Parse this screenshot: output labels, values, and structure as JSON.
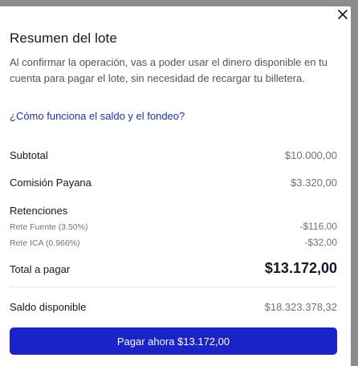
{
  "modal": {
    "title": "Resumen del lote",
    "description": "Al confirmar la operación, vas a poder usar el dinero disponible en tu cuenta para pagar el lote, sin necesidad de recargar tu billetera.",
    "help_link": "¿Cómo funciona el saldo y el fondeo?",
    "close_icon": "close-icon"
  },
  "summary": {
    "subtotal": {
      "label": "Subtotal",
      "value": "$10.000,00"
    },
    "commission": {
      "label": "Comisión Payana",
      "value": "$3.320,00"
    },
    "withholdings": {
      "label": "Retenciones",
      "items": [
        {
          "label": "Rete Fuente (3.50%)",
          "value": "-$116,00"
        },
        {
          "label": "Rete ICA (0.966%)",
          "value": "-$32,00"
        }
      ]
    },
    "total": {
      "label": "Total a pagar",
      "value": "$13.172,00"
    },
    "balance": {
      "label": "Saldo disponible",
      "value": "$18.323.378,32"
    }
  },
  "actions": {
    "pay_label": "Pagar ahora $13.172,00"
  },
  "colors": {
    "accent": "#1a23c9",
    "link": "#1d2cd4",
    "text": "#111827",
    "muted": "#6b7280"
  }
}
